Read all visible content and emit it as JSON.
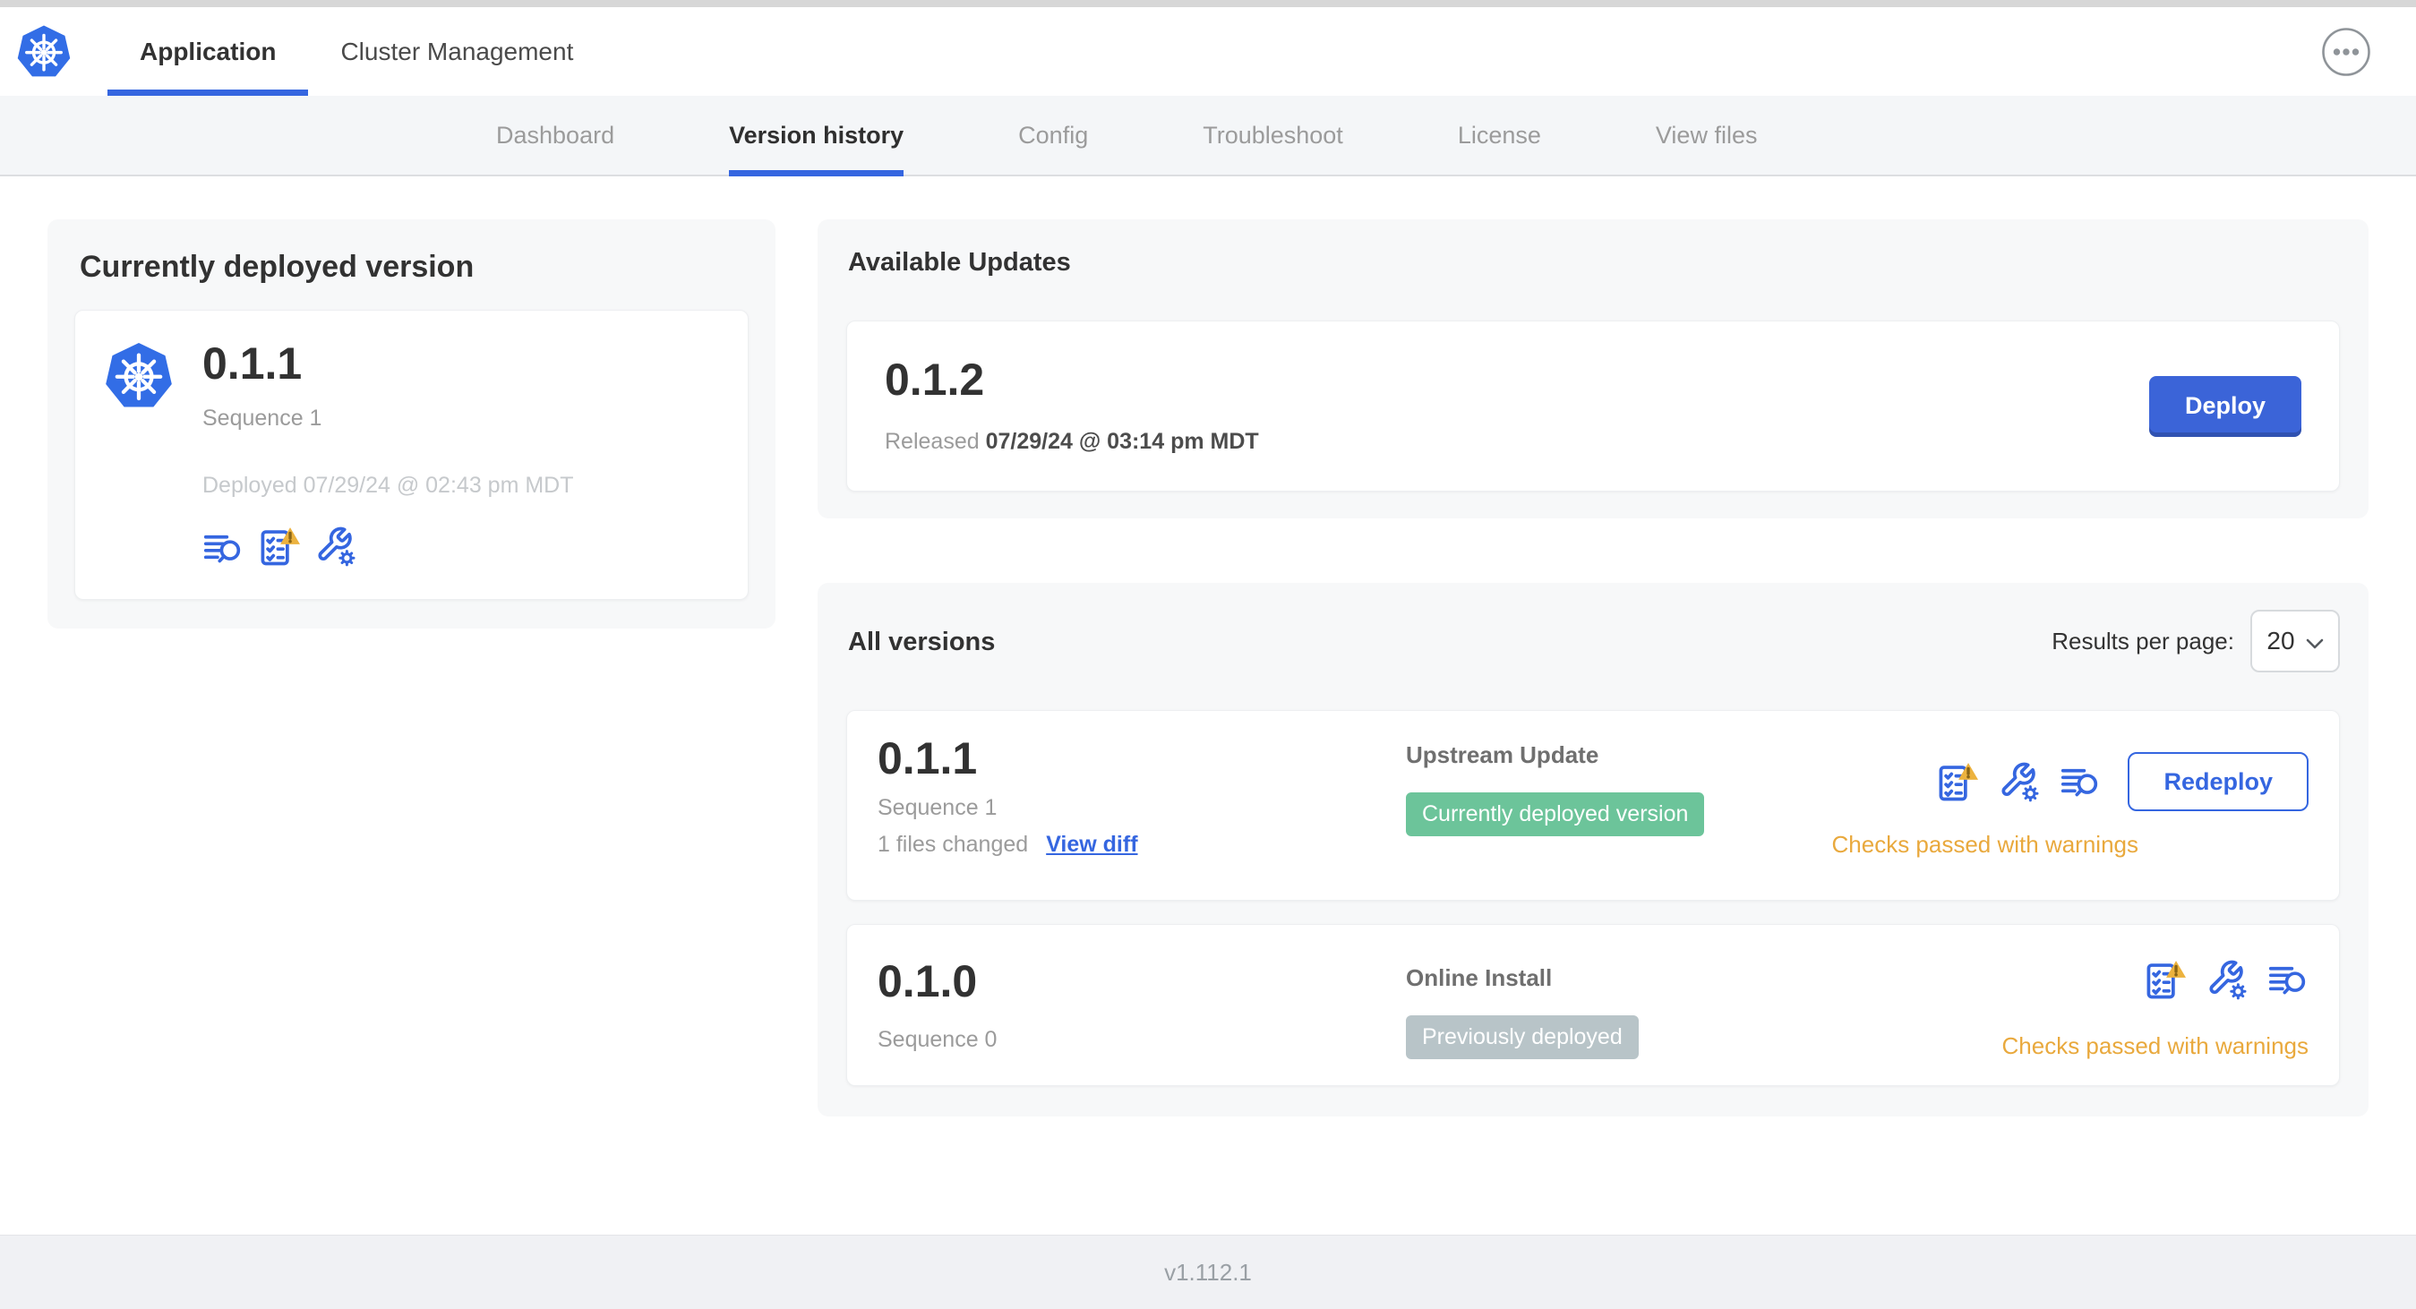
{
  "colors": {
    "accent_blue": "#3566e0",
    "deploy_blue": "#3b64d8",
    "k8s_blue": "#326de6",
    "green_badge": "#6cc49a",
    "gray_badge": "#b8c4c8",
    "warning_amber": "#e9a93d"
  },
  "header": {
    "tabs": [
      {
        "label": "Application",
        "active": true
      },
      {
        "label": "Cluster Management",
        "active": false
      }
    ],
    "menu_icon": "ellipsis-in-circle"
  },
  "subnav": {
    "items": [
      {
        "label": "Dashboard",
        "active": false
      },
      {
        "label": "Version history",
        "active": true
      },
      {
        "label": "Config",
        "active": false
      },
      {
        "label": "Troubleshoot",
        "active": false
      },
      {
        "label": "License",
        "active": false
      },
      {
        "label": "View files",
        "active": false
      }
    ]
  },
  "current": {
    "title": "Currently deployed version",
    "version": "0.1.1",
    "sequence": "Sequence 1",
    "deployed": "Deployed 07/29/24 @ 02:43 pm MDT",
    "icons": [
      "deploy-logs-icon",
      "preflight-checks-warning-icon",
      "edit-config-icon"
    ]
  },
  "updates": {
    "title": "Available Updates",
    "version": "0.1.2",
    "released_label": "Released",
    "released_date": "07/29/24 @ 03:14 pm MDT",
    "deploy_label": "Deploy"
  },
  "all_versions": {
    "title": "All versions",
    "results_per_page_label": "Results per page:",
    "results_per_page_value": "20",
    "rows": [
      {
        "version": "0.1.1",
        "sequence": "Sequence 1",
        "files_changed": "1 files changed",
        "view_diff_label": "View diff",
        "source": "Upstream Update",
        "badge_label": "Currently deployed version",
        "badge_type": "green",
        "action_label": "Redeploy",
        "status": "Checks passed with warnings"
      },
      {
        "version": "0.1.0",
        "sequence": "Sequence 0",
        "source": "Online Install",
        "badge_label": "Previously deployed",
        "badge_type": "gray",
        "status": "Checks passed with warnings"
      }
    ]
  },
  "footer": {
    "app_version": "v1.112.1"
  }
}
